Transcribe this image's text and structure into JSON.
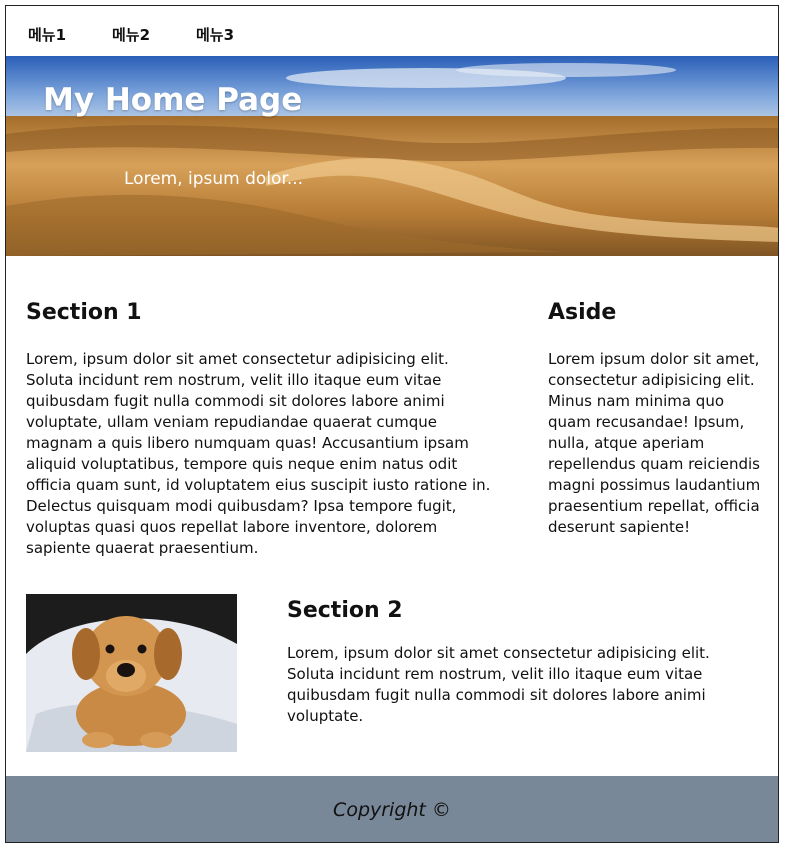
{
  "nav": {
    "items": [
      {
        "label": "메뉴1"
      },
      {
        "label": "메뉴2"
      },
      {
        "label": "메뉴3"
      }
    ]
  },
  "hero": {
    "title": "My Home Page",
    "subtitle": "Lorem, ipsum dolor..."
  },
  "section1": {
    "title": "Section 1",
    "text": "Lorem, ipsum dolor sit amet consectetur adipisicing elit. Soluta incidunt rem nostrum, velit illo itaque eum vitae quibusdam fugit nulla commodi sit dolores labore animi voluptate, ullam veniam repudiandae quaerat cumque magnam a quis libero numquam quas! Accusantium ipsam aliquid voluptatibus, tempore quis neque enim natus odit officia quam sunt, id voluptatem eius suscipit iusto ratione in. Delectus quisquam modi quibusdam? Ipsa tempore fugit, voluptas quasi quos repellat labore inventore, dolorem sapiente quaerat praesentium."
  },
  "aside": {
    "title": "Aside",
    "text": "Lorem ipsum dolor sit amet, consectetur adipisicing elit. Minus nam minima quo quam recusandae! Ipsum, nulla, atque aperiam repellendus quam reiciendis magni possimus laudantium praesentium repellat, officia deserunt sapiente!"
  },
  "section2": {
    "title": "Section 2",
    "text": "Lorem, ipsum dolor sit amet consectetur adipisicing elit. Soluta incidunt rem nostrum, velit illo itaque eum vitae quibusdam fugit nulla commodi sit dolores labore animi voluptate."
  },
  "footer": {
    "text": "Copyright ©"
  },
  "colors": {
    "footer_bg": "#798898",
    "hero_title": "#ffffff"
  }
}
